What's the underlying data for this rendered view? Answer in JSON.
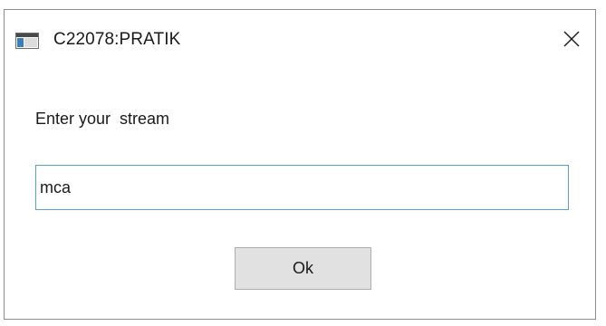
{
  "window": {
    "title": "C22078:PRATIK",
    "app_icon": "window-app-icon",
    "close_icon": "close-icon"
  },
  "prompt": {
    "label": "Enter your  stream"
  },
  "input": {
    "value": "mca"
  },
  "buttons": {
    "ok_label": "Ok"
  },
  "colors": {
    "input_border": "#5b9ec9",
    "button_bg": "#e1e1e1"
  }
}
